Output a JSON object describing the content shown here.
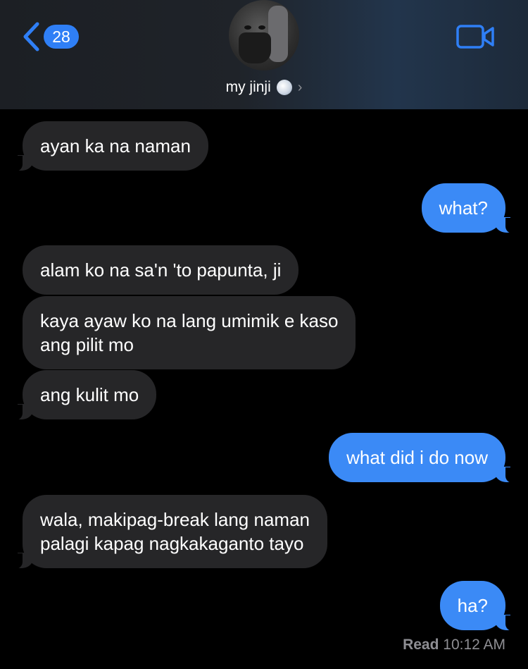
{
  "header": {
    "back_badge": "28",
    "contact_name": "my jinji",
    "contact_emoji": "bubble-emoji",
    "video_icon": "video-camera-icon"
  },
  "messages": [
    {
      "dir": "in",
      "lines": [
        "ayan ka na naman"
      ]
    },
    {
      "dir": "out",
      "lines": [
        "what?"
      ]
    },
    {
      "dir": "in",
      "lines": [
        "alam ko na sa'n 'to papunta, ji"
      ]
    },
    {
      "dir": "in",
      "lines": [
        "kaya ayaw ko na lang umimik e kaso",
        "ang pilit mo"
      ]
    },
    {
      "dir": "in",
      "lines": [
        "ang kulit mo"
      ]
    },
    {
      "dir": "out",
      "lines": [
        "what did i do now"
      ]
    },
    {
      "dir": "in",
      "lines": [
        "wala, makipag-break lang naman",
        "palagi kapag nagkakaganto tayo"
      ]
    },
    {
      "dir": "out",
      "lines": [
        "ha?"
      ]
    }
  ],
  "receipt": {
    "status": "Read",
    "time": "10:12 AM"
  },
  "colors": {
    "outgoing": "#3b8af6",
    "incoming": "#262628",
    "accent": "#2f7ff6"
  }
}
